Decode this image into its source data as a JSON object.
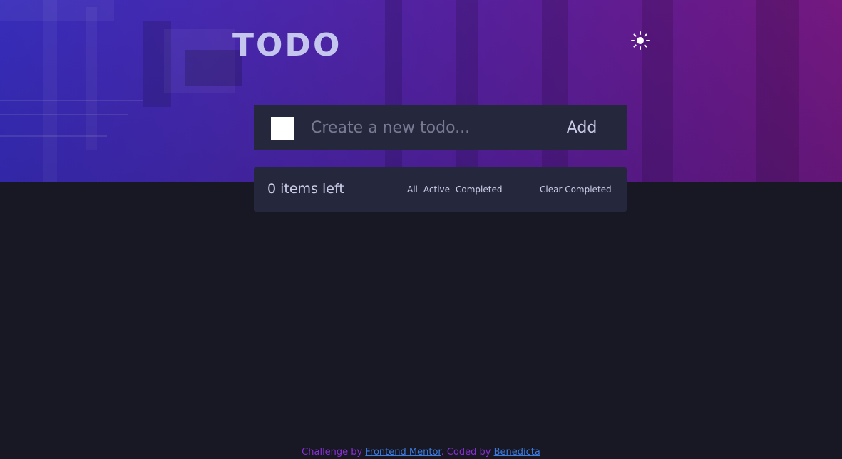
{
  "app": {
    "title": "TODO",
    "theme_toggle_icon": "sun-icon"
  },
  "new_todo": {
    "placeholder": "Create a new todo...",
    "value": "",
    "add_label": "Add"
  },
  "footer": {
    "items_left": "0 items left",
    "filters": [
      "All",
      "Active",
      "Completed"
    ],
    "clear_label": "Clear Completed"
  },
  "attribution": {
    "prefix": "Challenge by ",
    "link1": "Frontend Mentor",
    "middle": ". Coded by ",
    "link2": "Benedicta"
  },
  "colors": {
    "background": "#181824",
    "card": "#25273c",
    "gradient_start": "#3a2fc4",
    "gradient_end": "#7a1a86",
    "attribution_text": "#8b2fd6",
    "attribution_link": "#3c7be0"
  }
}
